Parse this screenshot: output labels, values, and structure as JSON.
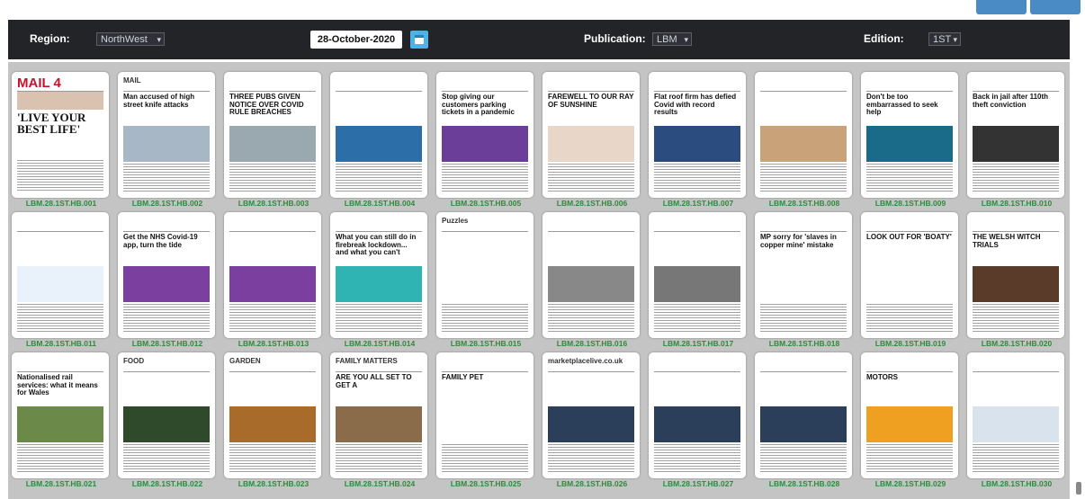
{
  "toolbar": {
    "region_label": "Region:",
    "region_value": "NorthWest",
    "date_value": "28-October-2020",
    "publication_label": "Publication:",
    "publication_value": "LBM",
    "edition_label": "Edition:",
    "edition_value": "1ST"
  },
  "pages": [
    {
      "caption": "LBM.28.1ST.HB.001",
      "masthead": "MAIL 4",
      "headline": "'LIVE YOUR BEST LIFE'"
    },
    {
      "caption": "LBM.28.1ST.HB.002",
      "masthead": "MAIL",
      "headline": "Man accused of high street knife attacks"
    },
    {
      "caption": "LBM.28.1ST.HB.003",
      "masthead": "",
      "headline": "THREE PUBS GIVEN NOTICE OVER COVID RULE BREACHES"
    },
    {
      "caption": "LBM.28.1ST.HB.004",
      "masthead": "",
      "headline": ""
    },
    {
      "caption": "LBM.28.1ST.HB.005",
      "masthead": "",
      "headline": "Stop giving our customers parking tickets in a pandemic"
    },
    {
      "caption": "LBM.28.1ST.HB.006",
      "masthead": "",
      "headline": "FAREWELL TO OUR RAY OF SUNSHINE"
    },
    {
      "caption": "LBM.28.1ST.HB.007",
      "masthead": "",
      "headline": "Flat roof firm has defied Covid with record results"
    },
    {
      "caption": "LBM.28.1ST.HB.008",
      "masthead": "",
      "headline": ""
    },
    {
      "caption": "LBM.28.1ST.HB.009",
      "masthead": "",
      "headline": "Don't be too embarrassed to seek help"
    },
    {
      "caption": "LBM.28.1ST.HB.010",
      "masthead": "",
      "headline": "Back in jail after 110th theft conviction"
    },
    {
      "caption": "LBM.28.1ST.HB.011",
      "masthead": "",
      "headline": ""
    },
    {
      "caption": "LBM.28.1ST.HB.012",
      "masthead": "",
      "headline": "Get the NHS Covid-19 app, turn the tide"
    },
    {
      "caption": "LBM.28.1ST.HB.013",
      "masthead": "",
      "headline": ""
    },
    {
      "caption": "LBM.28.1ST.HB.014",
      "masthead": "",
      "headline": "What you can still do in firebreak lockdown... and what you can't"
    },
    {
      "caption": "LBM.28.1ST.HB.015",
      "masthead": "Puzzles",
      "headline": ""
    },
    {
      "caption": "LBM.28.1ST.HB.016",
      "masthead": "",
      "headline": ""
    },
    {
      "caption": "LBM.28.1ST.HB.017",
      "masthead": "",
      "headline": ""
    },
    {
      "caption": "LBM.28.1ST.HB.018",
      "masthead": "",
      "headline": "MP sorry for 'slaves in copper mine' mistake"
    },
    {
      "caption": "LBM.28.1ST.HB.019",
      "masthead": "",
      "headline": "LOOK OUT FOR 'BOATY'"
    },
    {
      "caption": "LBM.28.1ST.HB.020",
      "masthead": "",
      "headline": "THE WELSH WITCH TRIALS"
    },
    {
      "caption": "LBM.28.1ST.HB.021",
      "masthead": "",
      "headline": "Nationalised rail services: what it means for Wales"
    },
    {
      "caption": "LBM.28.1ST.HB.022",
      "masthead": "FOOD",
      "headline": ""
    },
    {
      "caption": "LBM.28.1ST.HB.023",
      "masthead": "GARDEN",
      "headline": ""
    },
    {
      "caption": "LBM.28.1ST.HB.024",
      "masthead": "FAMILY MATTERS",
      "headline": "ARE YOU ALL SET TO GET A"
    },
    {
      "caption": "LBM.28.1ST.HB.025",
      "masthead": "",
      "headline": "FAMILY PET"
    },
    {
      "caption": "LBM.28.1ST.HB.026",
      "masthead": "marketplacelive.co.uk",
      "headline": ""
    },
    {
      "caption": "LBM.28.1ST.HB.027",
      "masthead": "",
      "headline": ""
    },
    {
      "caption": "LBM.28.1ST.HB.028",
      "masthead": "",
      "headline": ""
    },
    {
      "caption": "LBM.28.1ST.HB.029",
      "masthead": "",
      "headline": "MOTORS"
    },
    {
      "caption": "LBM.28.1ST.HB.030",
      "masthead": "",
      "headline": ""
    }
  ],
  "colors": {
    "caption": "#2e8b3a",
    "toolbar_bg": "#222428",
    "accent": "#4cb3e6",
    "grid_bg": "#c4c4c4"
  }
}
